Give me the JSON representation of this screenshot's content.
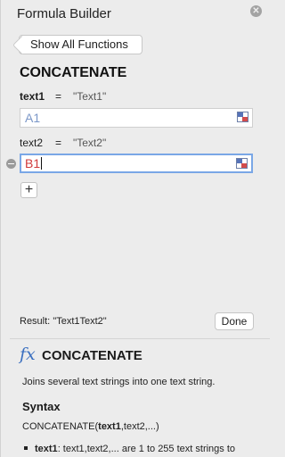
{
  "header": {
    "title": "Formula Builder"
  },
  "nav": {
    "back_label": "Show All Functions"
  },
  "function": {
    "name": "CONCATENATE"
  },
  "arguments": [
    {
      "name": "text1",
      "equals": "=",
      "preview": "\"Text1\"",
      "value": "A1"
    },
    {
      "name": "text2",
      "equals": "=",
      "preview": "\"Text2\"",
      "value": "B1"
    }
  ],
  "add_argument": {
    "label": "+"
  },
  "result": {
    "label": "Result:",
    "value": "\"Text1Text2\""
  },
  "done": {
    "label": "Done"
  },
  "help": {
    "icon_text": "fx",
    "name": "CONCATENATE",
    "description": "Joins several text strings into one text string.",
    "syntax_heading": "Syntax",
    "syntax_prefix": "CONCATENATE(",
    "syntax_bold": "text1",
    "syntax_suffix": ",text2,...)",
    "bullet_term": "text1",
    "bullet_text": ": text1,text2,... are 1 to 255 text strings to"
  },
  "colors": {
    "accent": "#3a6fbf",
    "ref_a1": "#7b97c8",
    "ref_b1": "#d03a3a",
    "focus": "#7aa7e6"
  }
}
